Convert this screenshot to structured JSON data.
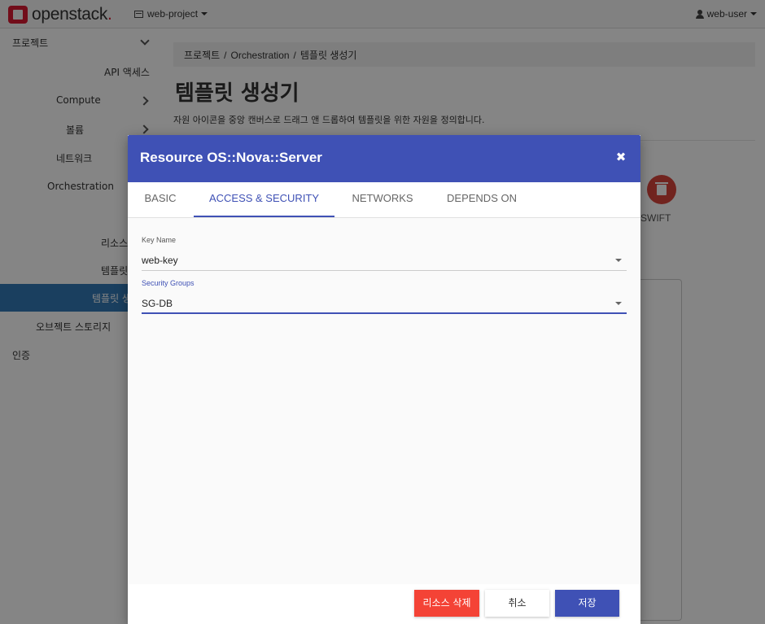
{
  "topbar": {
    "brand": "openstack",
    "brand_dot": ".",
    "project": "web-project",
    "user": "web-user"
  },
  "sidebar": {
    "project": "프로젝트",
    "api_access": "API 액세스",
    "compute": "Compute",
    "volumes": "볼륨",
    "network": "네트워크",
    "orchestration": "Orchestration",
    "resource_types": "리소스",
    "template_versions": "템플릿",
    "template_generator": "템플릿 생",
    "object_store": "오브젝트 스토리지",
    "identity": "인증"
  },
  "breadcrumb": {
    "items": [
      "프로젝트",
      "Orchestration",
      "템플릿 생성기"
    ],
    "separator": "/"
  },
  "page": {
    "title": "템플릿 생성기",
    "description": "자원 아이콘을 중앙 캔버스로 드래그 앤 드롭하여 템플릿을 위한 자원을 정의합니다.",
    "swift_label": "SWIFT"
  },
  "modal": {
    "title": "Resource OS::Nova::Server",
    "close_glyph": "✖",
    "tabs": [
      {
        "label": "BASIC",
        "active": false
      },
      {
        "label": "ACCESS & SECURITY",
        "active": true
      },
      {
        "label": "NETWORKS",
        "active": false
      },
      {
        "label": "DEPENDS ON",
        "active": false
      }
    ],
    "fields": {
      "key_name": {
        "label": "Key Name",
        "value": "web-key"
      },
      "security_groups": {
        "label": "Security Groups",
        "value": "SG-DB"
      }
    },
    "buttons": {
      "delete": "리소스 삭제",
      "cancel": "취소",
      "save": "저장"
    }
  },
  "colors": {
    "primary": "#3f51b5",
    "danger": "#f44336",
    "brand_red": "#da1a32",
    "sidebar_active": "#337ab7"
  }
}
